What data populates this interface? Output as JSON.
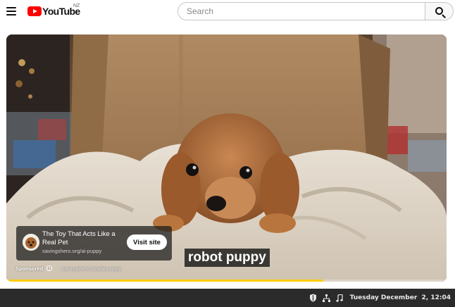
{
  "header": {
    "brand": "YouTube",
    "region": "NZ",
    "search_placeholder": "Search"
  },
  "player": {
    "caption": "robot puppy",
    "progress_fraction": 0.72,
    "ad": {
      "title": "The Toy That Acts Like a Real Pet",
      "url": "savingshero.org/ai-puppy",
      "cta": "Visit site",
      "sponsored_label": "Sponsored",
      "info_glyph": "i",
      "separator": "·",
      "sponsored_url": "savingshero.org/ai-puppy"
    }
  },
  "taskbar": {
    "clock": "Tuesday December  2, 12:04",
    "icons": [
      "shield-icon",
      "network-icon",
      "music-note-icon"
    ]
  },
  "colors": {
    "brand_red": "#ff0000",
    "progress": "#ffcc00",
    "taskbar_bg": "#2b2b2b"
  }
}
